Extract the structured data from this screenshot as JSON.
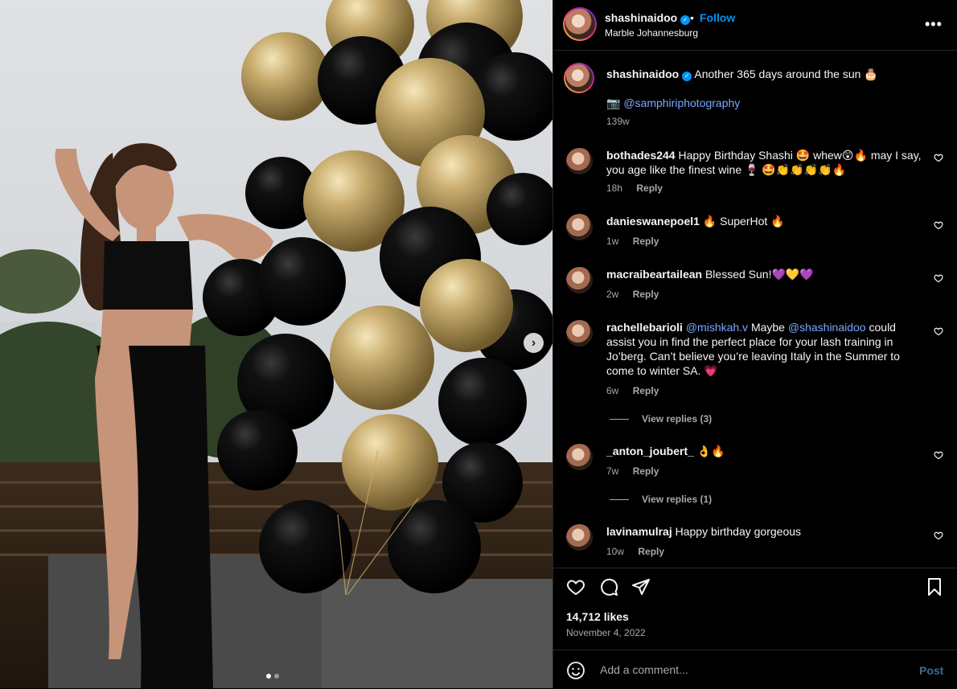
{
  "post": {
    "username": "shashinaidoo",
    "location": "Marble Johannesburg",
    "follow_label": "Follow",
    "separator": "•",
    "more_label": "•••",
    "verified_glyph": "✓"
  },
  "caption": {
    "username": "shashinaidoo",
    "text": "Another 365 days around the sun 🎂",
    "credit_prefix": "📷",
    "credit_mention": "@samphiriphotography",
    "time": "139w"
  },
  "comments": [
    {
      "username": "bothades244",
      "text": "Happy Birthday Shashi 🤩 whew😲🔥 may I say, you age like the finest wine 🍷 🤩👏👏👏👏🔥",
      "time": "18h",
      "reply_label": "Reply"
    },
    {
      "username": "danieswanepoel1",
      "text": "🔥 SuperHot 🔥",
      "time": "1w",
      "reply_label": "Reply"
    },
    {
      "username": "macraibeartailean",
      "text": "Blessed Sun!💜💛💜",
      "time": "2w",
      "reply_label": "Reply"
    },
    {
      "username": "rachellebarioli",
      "mention1": "@mishkah.v",
      "text_mid": " Maybe ",
      "mention2": "@shashinaidoo",
      "text_end": " could assist you in find the perfect place for your lash training in Jo’berg. Can’t believe you’re leaving Italy in the Summer to come to winter SA. 💗",
      "time": "6w",
      "reply_label": "Reply",
      "view_replies": "View replies (3)"
    },
    {
      "username": "_anton_joubert_",
      "text": "👌🔥",
      "time": "7w",
      "reply_label": "Reply",
      "view_replies": "View replies (1)"
    },
    {
      "username": "lavinamulraj",
      "text": "Happy birthday gorgeous",
      "time": "10w",
      "reply_label": "Reply"
    }
  ],
  "stats": {
    "likes": "14,712 likes",
    "date": "November 4, 2022"
  },
  "composer": {
    "placeholder": "Add a comment...",
    "post_label": "Post"
  },
  "media": {
    "next_glyph": "›",
    "carousel_total": 2,
    "carousel_active": 1
  },
  "icons": {
    "like": "heart-icon",
    "comment": "comment-icon",
    "share": "share-icon",
    "save": "bookmark-icon",
    "emoji": "emoji-icon",
    "comment_like": "small-heart-icon"
  },
  "colors": {
    "accent": "#0095f6",
    "background": "#000000",
    "secondary_text": "#a8a8a8",
    "link": "#7aa8ff"
  }
}
